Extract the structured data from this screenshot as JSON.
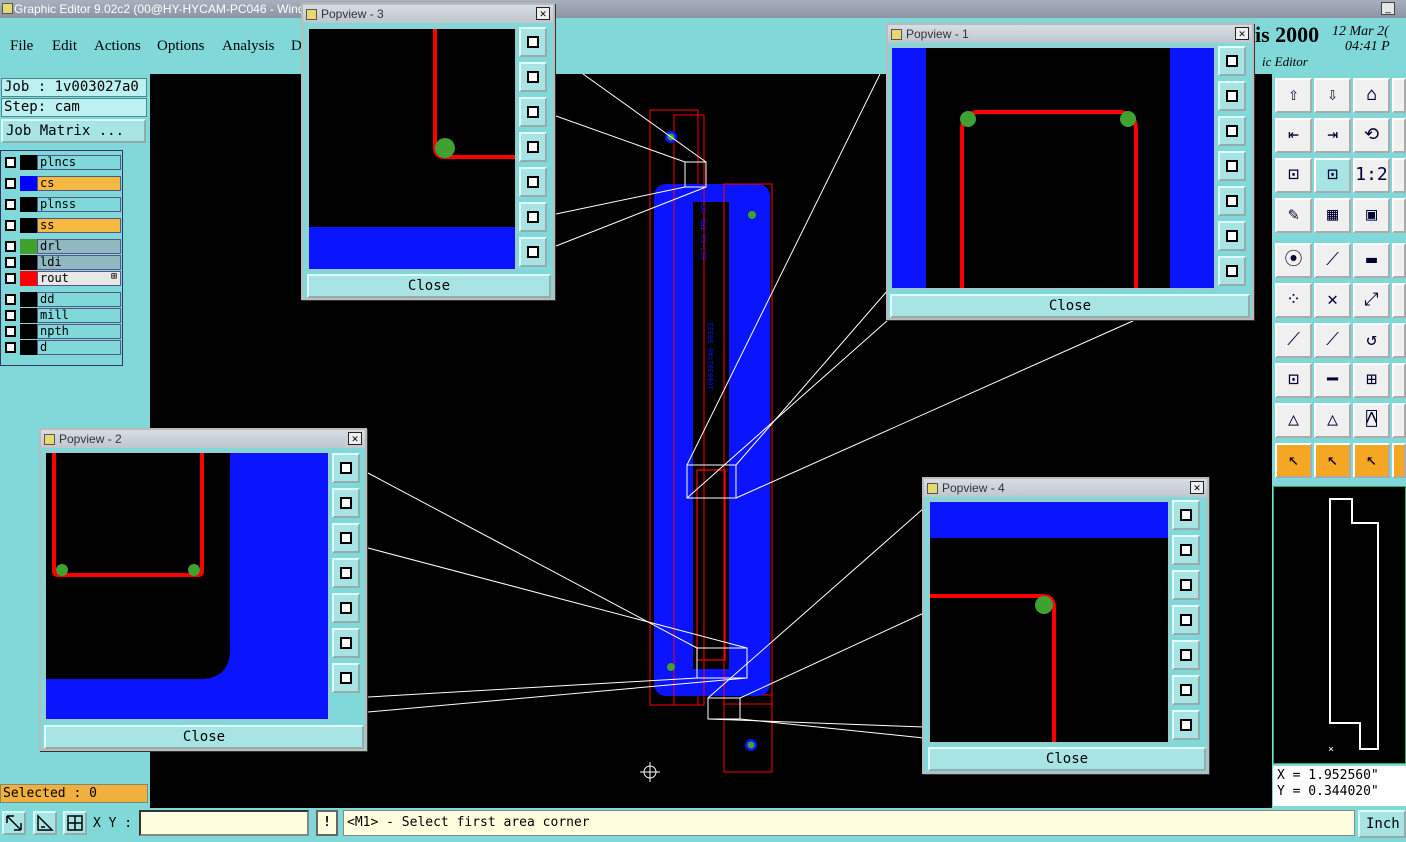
{
  "window": {
    "title": "Graphic Editor 9.02c2 (00@HY-HYCAM-PC046 - Wind",
    "min": "_",
    "max": "□"
  },
  "menu": [
    "File",
    "Edit",
    "Actions",
    "Options",
    "Analysis",
    "D"
  ],
  "brand": {
    "name": "is 2000",
    "sub": "ic Editor",
    "date": "12 Mar 2(",
    "time": "04:41 P"
  },
  "job": {
    "job_label": "Job : 1v003027a0",
    "step_label": "Step: cam",
    "matrix_button": "Job Matrix ..."
  },
  "layers": [
    {
      "name": "plncs",
      "swatch": "#000000",
      "bg": "#80d8d8"
    },
    {
      "name": "cs",
      "swatch": "#0000ff",
      "bg": "#f5b840"
    },
    {
      "name": "plnss",
      "swatch": "#000000",
      "bg": "#80d8d8"
    },
    {
      "name": "ss",
      "swatch": "#000000",
      "bg": "#f5b840"
    },
    {
      "name": "drl",
      "swatch": "#40a030",
      "bg": "#90b8c0"
    },
    {
      "name": "ldi",
      "swatch": "#000000",
      "bg": "#90b8c0"
    },
    {
      "name": "rout",
      "swatch": "#ff0000",
      "bg": "#e8e8e8",
      "marker": "⊞"
    },
    {
      "name": "dd",
      "swatch": "#000000",
      "bg": "#80d8d8"
    },
    {
      "name": "mill",
      "swatch": "#000000",
      "bg": "#80d8d8"
    },
    {
      "name": "npth",
      "swatch": "#000000",
      "bg": "#80d8d8"
    },
    {
      "name": "d",
      "swatch": "#000000",
      "bg": "#80d8d8"
    }
  ],
  "selected": "Selected : 0",
  "status": {
    "xy_label": "X Y :",
    "xy_value": "",
    "excl": "!",
    "message": "<M1> - Select first area corner",
    "units": "Inch"
  },
  "coords": {
    "x": "X = 1.952560\"",
    "y": "Y = 0.344020\""
  },
  "board_text": {
    "a": "ES7 S3-TMS 9PCS",
    "b": "1V003027A0 S0322"
  },
  "popviews": [
    {
      "title": "Popview - 3",
      "close": "Close"
    },
    {
      "title": "Popview - 1",
      "close": "Close"
    },
    {
      "title": "Popview - 2",
      "close": "Close"
    },
    {
      "title": "Popview - 4",
      "close": "Close"
    }
  ],
  "colors": {
    "panel": "#80d8d8",
    "copper": "#0a14ff",
    "rout": "#ff0000",
    "drill": "#40a030",
    "highlight": "#f5b840"
  }
}
